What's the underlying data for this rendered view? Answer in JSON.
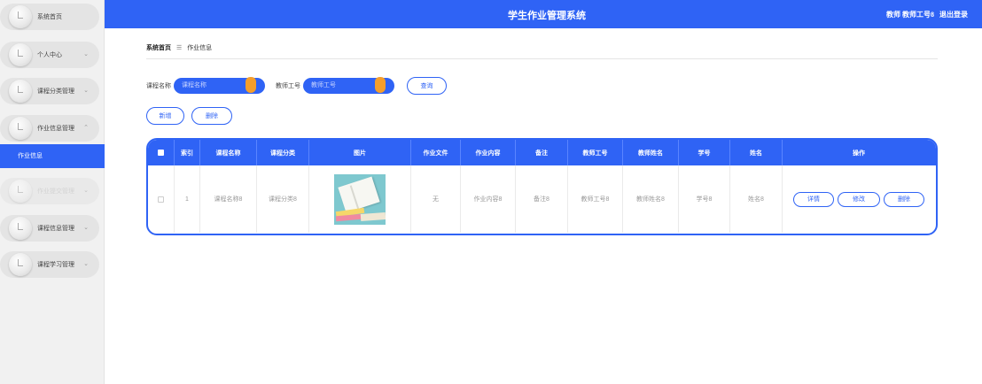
{
  "header": {
    "title": "学生作业管理系统",
    "user": "教师 教师工号8",
    "logout": "退出登录"
  },
  "sidebar": {
    "items": [
      {
        "label": "系统首页",
        "has_chevron": false
      },
      {
        "label": "个人中心",
        "has_chevron": true
      },
      {
        "label": "课程分类管理",
        "has_chevron": true
      },
      {
        "label": "作业信息管理",
        "has_chevron": true,
        "expanded": true
      },
      {
        "label": "作业提交管理",
        "has_chevron": true
      },
      {
        "label": "课程信息管理",
        "has_chevron": true
      },
      {
        "label": "课程学习管理",
        "has_chevron": true
      }
    ],
    "active_sub": "作业信息",
    "chevron_down": "⌄",
    "chevron_up": "⌃"
  },
  "breadcrumb": {
    "home": "系统首页",
    "sep": "☰",
    "current": "作业信息"
  },
  "search": {
    "course_label": "课程名称",
    "course_placeholder": "课程名称",
    "teacher_label": "教师工号",
    "teacher_placeholder": "教师工号",
    "query_button": "查询"
  },
  "actions": {
    "add": "新增",
    "delete": "删除"
  },
  "table": {
    "headers": [
      "索引",
      "课程名称",
      "课程分类",
      "图片",
      "作业文件",
      "作业内容",
      "备注",
      "教师工号",
      "教师姓名",
      "学号",
      "姓名",
      "操作"
    ],
    "rows": [
      {
        "index": "1",
        "course_name": "课程名称8",
        "course_category": "课程分类8",
        "file": "无",
        "content": "作业内容8",
        "remark": "备注8",
        "teacher_no": "教师工号8",
        "teacher_name": "教师姓名8",
        "student_no": "学号8",
        "name": "姓名8",
        "ops": {
          "detail": "详情",
          "edit": "修改",
          "delete": "删除"
        }
      }
    ]
  },
  "colors": {
    "primary": "#2f63f5",
    "knob": "#f59e2b",
    "sidebar_bg": "#f1f1f1"
  },
  "icons": {
    "menu_icon": "check-circle-icon",
    "breadcrumb_sep": "menu-icon"
  }
}
